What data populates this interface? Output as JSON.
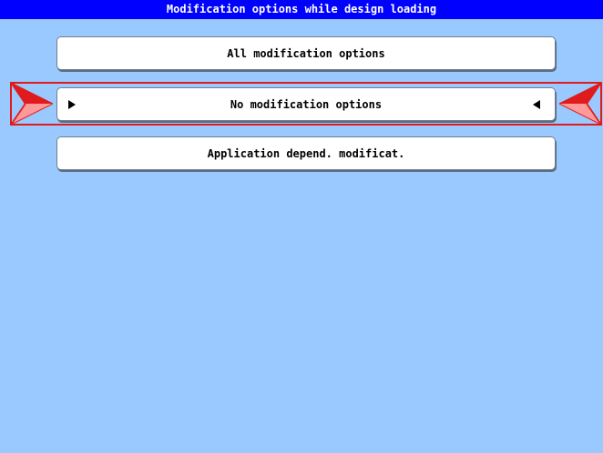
{
  "window": {
    "title": "Modification options while design loading"
  },
  "options": [
    {
      "label": "All modification options",
      "selected": false
    },
    {
      "label": "No modification options",
      "selected": true
    },
    {
      "label": "Application depend. modificat.",
      "selected": false
    }
  ],
  "colors": {
    "background": "#99c9ff",
    "title_bar": "#0000ff",
    "title_text": "#ffffff",
    "selection": "#e01b1b",
    "button_face": "#ffffff"
  },
  "icons": {
    "selection_left_marker": "selection-marker-left-icon",
    "selection_right_marker": "selection-marker-right-icon",
    "row_pointer_right": "arrow-right-icon",
    "row_pointer_left": "arrow-left-icon"
  }
}
